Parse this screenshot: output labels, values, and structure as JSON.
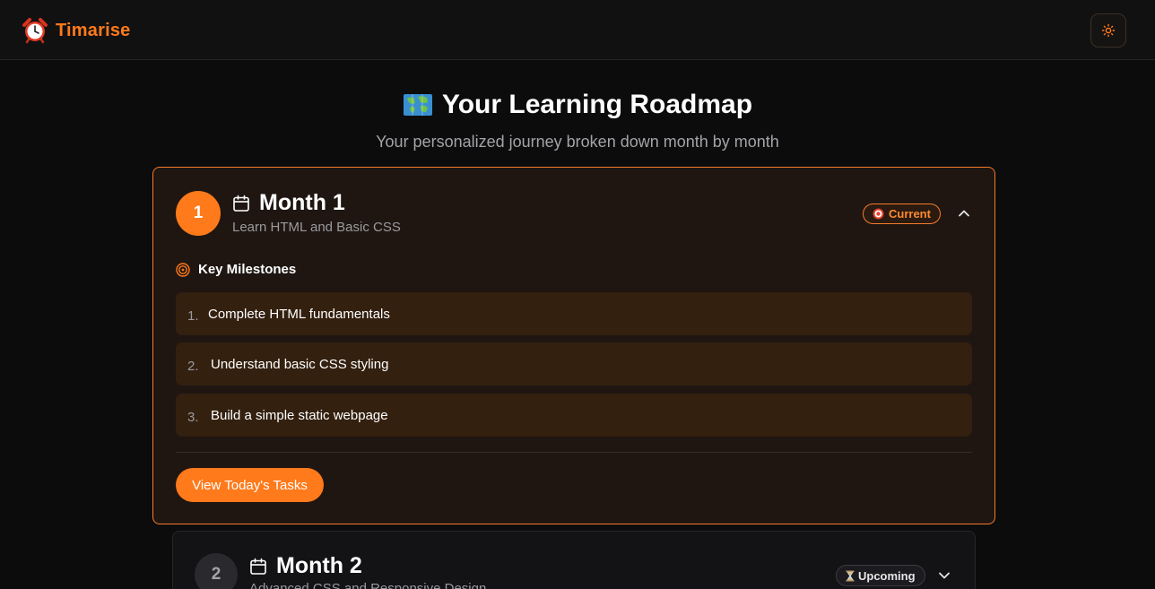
{
  "app": {
    "name": "Timarise",
    "logo_icon": "alarm-clock-icon",
    "theme_toggle_icon": "sun-icon"
  },
  "page": {
    "title": "Your Learning Roadmap",
    "title_icon": "world-map-icon",
    "subtitle": "Your personalized journey broken down month by month"
  },
  "colors": {
    "accent": "#ff7a1a",
    "background": "#0c0c0d",
    "card_active": "#1f1612",
    "milestone_bg": "#33200f"
  },
  "months": [
    {
      "number": "1",
      "title": "Month 1",
      "subtitle": "Learn HTML and Basic CSS",
      "status": "Current",
      "status_icon": "target-icon",
      "expanded": true,
      "milestones_label": "Key Milestones",
      "milestones": [
        {
          "num": "1.",
          "text": "Complete HTML fundamentals"
        },
        {
          "num": "2.",
          "text": "Understand basic CSS styling"
        },
        {
          "num": "3.",
          "text": "Build a simple static webpage"
        }
      ],
      "action_label": "View Today's Tasks"
    },
    {
      "number": "2",
      "title": "Month 2",
      "subtitle": "Advanced CSS and Responsive Design",
      "status": "Upcoming",
      "status_icon": "hourglass-icon",
      "expanded": false
    }
  ]
}
